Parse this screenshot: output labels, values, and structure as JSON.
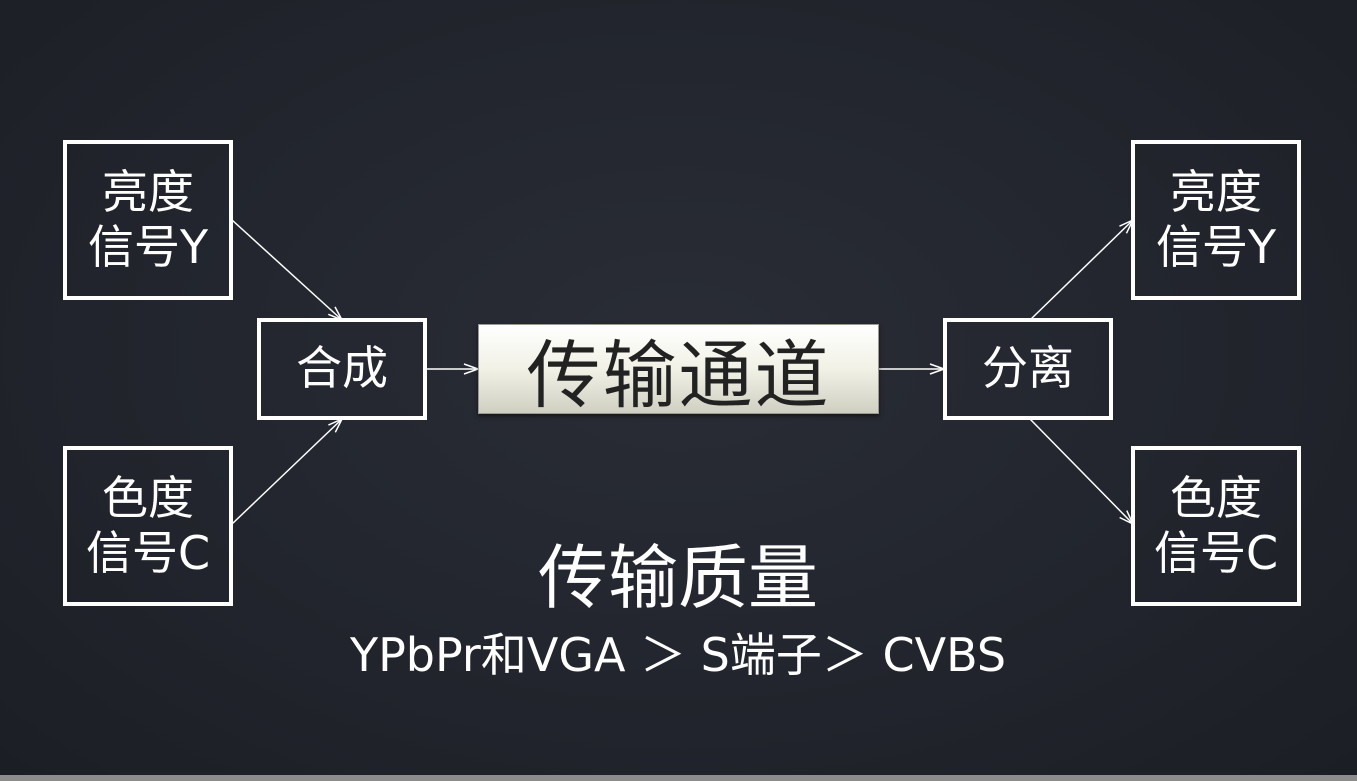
{
  "input": {
    "luma": {
      "line1": "亮度",
      "line2": "信号Y"
    },
    "chroma": {
      "line1": "色度",
      "line2": "信号C"
    }
  },
  "combine_label": "合成",
  "channel_label": "传输通道",
  "separate_label": "分离",
  "output": {
    "luma": {
      "line1": "亮度",
      "line2": "信号Y"
    },
    "chroma": {
      "line1": "色度",
      "line2": "信号C"
    }
  },
  "quality": {
    "title": "传输质量",
    "order": "YPbPr和VGA ＞ S端子＞ CVBS"
  },
  "colors": {
    "background": "#22252d",
    "stroke": "#ffffff",
    "channel_fill": "#f1f1e6",
    "channel_text": "#222222"
  }
}
